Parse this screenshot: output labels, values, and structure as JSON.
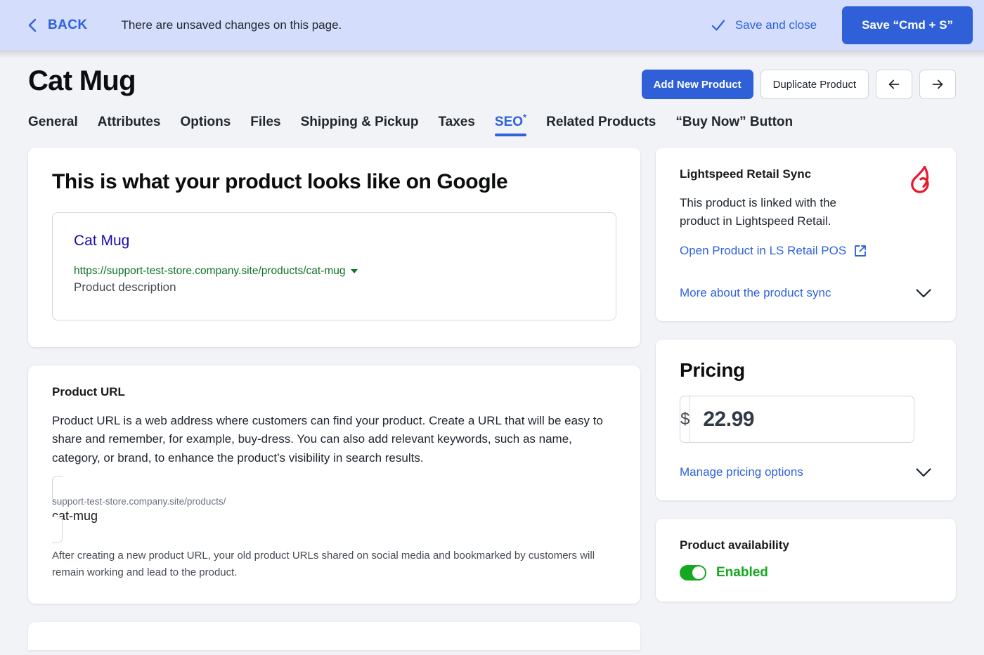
{
  "save_bar": {
    "back_label": "BACK",
    "unsaved_message": "There are unsaved changes on this page.",
    "save_and_close_label": "Save and close",
    "save_button_label": "Save “Cmd + S”",
    "background_color": "#d4ddfb",
    "accent_color": "#2f62dc"
  },
  "header": {
    "title": "Cat Mug",
    "add_new_product_label": "Add New Product",
    "duplicate_product_label": "Duplicate Product",
    "prev_arrow_icon": "arrow-left-icon",
    "next_arrow_icon": "arrow-right-icon"
  },
  "tabs": [
    {
      "label": "General",
      "active": false
    },
    {
      "label": "Attributes",
      "active": false
    },
    {
      "label": "Options",
      "active": false
    },
    {
      "label": "Files",
      "active": false
    },
    {
      "label": "Shipping & Pickup",
      "active": false
    },
    {
      "label": "Taxes",
      "active": false
    },
    {
      "label": "SEO",
      "active": true,
      "marker": "*"
    },
    {
      "label": "Related Products",
      "active": false
    },
    {
      "label": "“Buy Now” Button",
      "active": false
    }
  ],
  "google_preview": {
    "heading": "This is what your product looks like on Google",
    "result_title": "Cat Mug",
    "result_url": "https://support-test-store.company.site/products/cat-mug",
    "result_description": "Product description",
    "title_color": "#1a0dab",
    "url_color": "#0f7325"
  },
  "product_url": {
    "heading": "Product URL",
    "description": "Product URL is a web address where customers can find your product. Create a URL that will be easy to share and remember, for example, buy-dress. You can also add relevant keywords, such as name, category, or brand, to enhance the product’s visibility in search results.",
    "input_prefix": "support-test-store.company.site/products/",
    "input_value": "cat-mug",
    "input_placeholder": "cat-mug",
    "note": "After creating a new product URL, your old product URLs shared on social media and bookmarked by customers will remain working and lead to the product."
  },
  "lightspeed_sync": {
    "title": "Lightspeed Retail Sync",
    "logo_icon": "lightspeed-flame-icon",
    "logo_color": "#e8192c",
    "body": "This product is linked with the product in Lightspeed Retail.",
    "open_link_label": "Open Product in LS Retail POS",
    "external_icon": "external-link-icon",
    "more_link_label": "More about the product sync",
    "chevron_icon": "chevron-down-icon"
  },
  "pricing": {
    "title": "Pricing",
    "currency_symbol": "$",
    "price_value": "22.99",
    "manage_link_label": "Manage pricing options",
    "chevron_icon": "chevron-down-icon"
  },
  "availability": {
    "title": "Product availability",
    "toggle_state": "on",
    "status_label": "Enabled",
    "status_color": "#15a820"
  }
}
